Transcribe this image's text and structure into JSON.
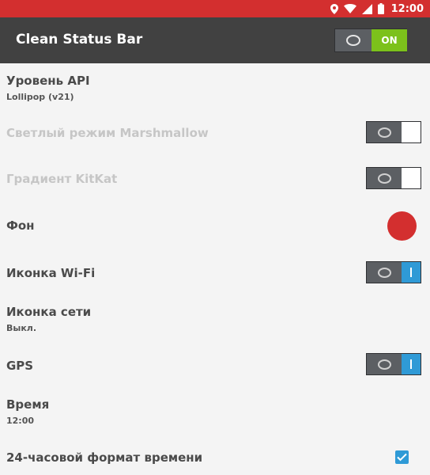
{
  "status_bar": {
    "time": "12:00",
    "icons": [
      "location-icon",
      "wifi-icon",
      "signal-icon",
      "battery-icon"
    ],
    "background": "#d32f2f"
  },
  "app_bar": {
    "title": "Clean Status Bar",
    "master_switch_label": "ON",
    "master_switch_state": "on",
    "accent": "#7cc11b"
  },
  "prefs": {
    "api_level": {
      "title": "Уровень API",
      "summary": "Lollipop (v21)"
    },
    "marshmallow_light": {
      "title": "Светлый режим Marshmallow",
      "state": "off",
      "enabled": false
    },
    "kitkat_gradient": {
      "title": "Градиент KitKat",
      "state": "off",
      "enabled": false
    },
    "background": {
      "title": "Фон",
      "color": "#d32f2f"
    },
    "wifi_icon": {
      "title": "Иконка Wi-Fi",
      "state": "on"
    },
    "network_icon": {
      "title": "Иконка сети",
      "summary": "Выкл."
    },
    "gps": {
      "title": "GPS",
      "state": "on"
    },
    "time": {
      "title": "Время",
      "summary": "12:00"
    },
    "format_24h": {
      "title": "24-часовой формат времени",
      "checked": true
    }
  },
  "colors": {
    "switch_on": "#2f9ad6",
    "switch_thumb": "#5c5f63",
    "disabled_text": "#c6c6c6"
  }
}
